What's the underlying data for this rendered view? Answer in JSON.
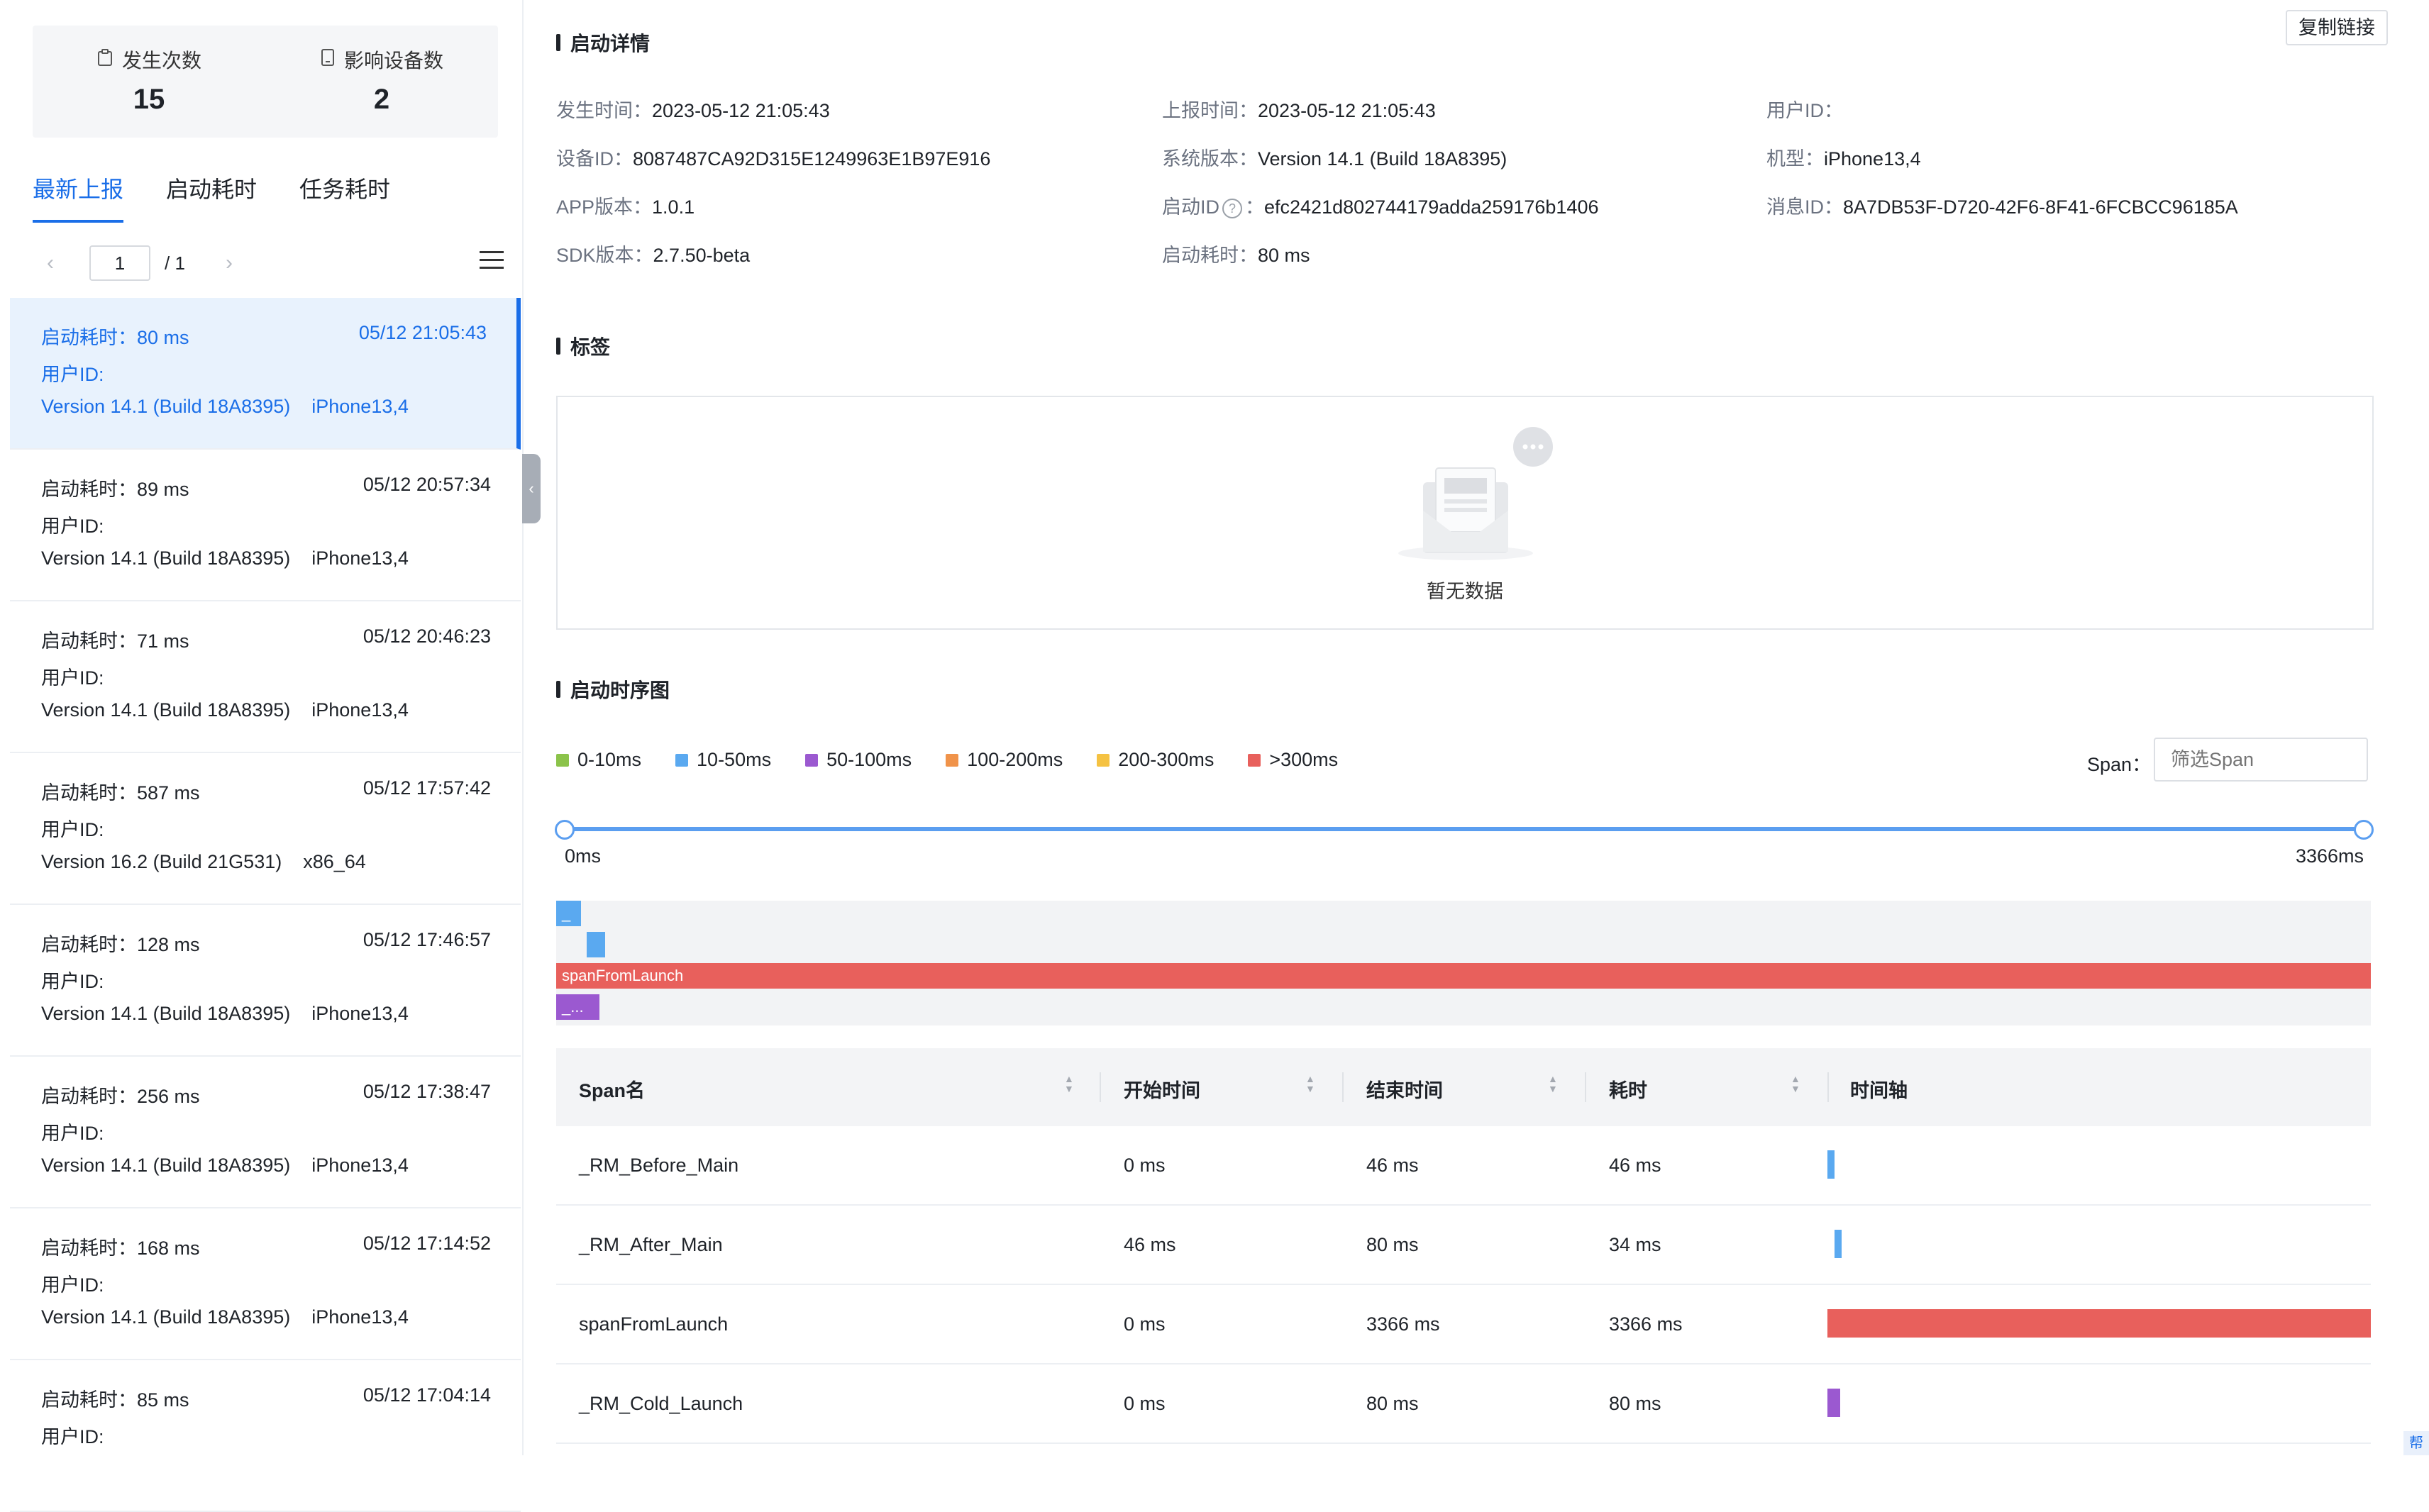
{
  "stats": [
    {
      "label": "发生次数",
      "value": "15",
      "icon": "clipboard-icon"
    },
    {
      "label": "影响设备数",
      "value": "2",
      "icon": "device-icon"
    }
  ],
  "tabs": [
    "最新上报",
    "启动耗时",
    "任务耗时"
  ],
  "pager": {
    "current": "1",
    "total": "/ 1"
  },
  "list": [
    {
      "duration": "启动耗时：80 ms",
      "time": "05/12 21:05:43",
      "user": "用户ID:",
      "version": "Version 14.1 (Build 18A8395)",
      "model": "iPhone13,4"
    },
    {
      "duration": "启动耗时：89 ms",
      "time": "05/12 20:57:34",
      "user": "用户ID:",
      "version": "Version 14.1 (Build 18A8395)",
      "model": "iPhone13,4"
    },
    {
      "duration": "启动耗时：71 ms",
      "time": "05/12 20:46:23",
      "user": "用户ID:",
      "version": "Version 14.1 (Build 18A8395)",
      "model": "iPhone13,4"
    },
    {
      "duration": "启动耗时：587 ms",
      "time": "05/12 17:57:42",
      "user": "用户ID:",
      "version": "Version 16.2 (Build 21G531)",
      "model": "x86_64"
    },
    {
      "duration": "启动耗时：128 ms",
      "time": "05/12 17:46:57",
      "user": "用户ID:",
      "version": "Version 14.1 (Build 18A8395)",
      "model": "iPhone13,4"
    },
    {
      "duration": "启动耗时：256 ms",
      "time": "05/12 17:38:47",
      "user": "用户ID:",
      "version": "Version 14.1 (Build 18A8395)",
      "model": "iPhone13,4"
    },
    {
      "duration": "启动耗时：168 ms",
      "time": "05/12 17:14:52",
      "user": "用户ID:",
      "version": "Version 14.1 (Build 18A8395)",
      "model": "iPhone13,4"
    },
    {
      "duration": "启动耗时：85 ms",
      "time": "05/12 17:04:14",
      "user": "用户ID:",
      "version": "",
      "model": ""
    }
  ],
  "details": {
    "title": "启动详情",
    "copy_link": "复制链接",
    "occur_time_k": "发生时间：",
    "occur_time_v": "2023-05-12 21:05:43",
    "report_time_k": "上报时间：",
    "report_time_v": "2023-05-12 21:05:43",
    "user_id_k": "用户ID：",
    "user_id_v": "",
    "device_id_k": "设备ID：",
    "device_id_v": "8087487CA92D315E1249963E1B97E916",
    "os_k": "系统版本：",
    "os_v": "Version 14.1 (Build 18A8395)",
    "model_k": "机型：",
    "model_v": "iPhone13,4",
    "app_ver_k": "APP版本：",
    "app_ver_v": "1.0.1",
    "launch_id_k": "启动ID",
    "launch_id_sep": "：",
    "launch_id_v": "efc2421d802744179adda259176b1406",
    "msg_id_k": "消息ID：",
    "msg_id_v": "8A7DB53F-D720-42F6-8F41-6FCBCC96185A",
    "sdk_k": "SDK版本：",
    "sdk_v": "2.7.50-beta",
    "launch_cost_k": "启动耗时：",
    "launch_cost_v": "80 ms"
  },
  "tags": {
    "title": "标签",
    "empty": "暂无数据"
  },
  "timeline": {
    "title": "启动时序图",
    "legend": [
      {
        "label": "0-10ms",
        "color": "#8bc34a"
      },
      {
        "label": "10-50ms",
        "color": "#5aa9f0"
      },
      {
        "label": "50-100ms",
        "color": "#9b59d0"
      },
      {
        "label": "100-200ms",
        "color": "#f0934a"
      },
      {
        "label": "200-300ms",
        "color": "#f5c242"
      },
      {
        "label": ">300ms",
        "color": "#e8605c"
      }
    ],
    "span_label": "Span",
    "span_colon": "：",
    "span_placeholder": "筛选Span",
    "range_start": "0ms",
    "range_end": "3366ms",
    "total_ms": 3366,
    "bars": [
      {
        "label": "_",
        "start": 0,
        "end": 46,
        "color": "#5aa9f0"
      },
      {
        "label": "",
        "start": 46,
        "end": 80,
        "color": "#5aa9f0"
      },
      {
        "label": "spanFromLaunch",
        "start": 0,
        "end": 3366,
        "color": "#e8605c"
      },
      {
        "label": "_...",
        "start": 0,
        "end": 80,
        "color": "#9b59d0"
      }
    ]
  },
  "table": {
    "headers": [
      "Span名",
      "开始时间",
      "结束时间",
      "耗时",
      "时间轴"
    ],
    "rows": [
      {
        "name": "_RM_Before_Main",
        "start": "0 ms",
        "end": "46 ms",
        "cost": "46 ms",
        "s": 0,
        "e": 46,
        "color": "#5aa9f0"
      },
      {
        "name": "_RM_After_Main",
        "start": "46 ms",
        "end": "80 ms",
        "cost": "34 ms",
        "s": 46,
        "e": 80,
        "color": "#5aa9f0"
      },
      {
        "name": "spanFromLaunch",
        "start": "0 ms",
        "end": "3366 ms",
        "cost": "3366 ms",
        "s": 0,
        "e": 3366,
        "color": "#e8605c"
      },
      {
        "name": "_RM_Cold_Launch",
        "start": "0 ms",
        "end": "80 ms",
        "cost": "80 ms",
        "s": 0,
        "e": 80,
        "color": "#9b59d0"
      }
    ]
  },
  "help": "帮"
}
